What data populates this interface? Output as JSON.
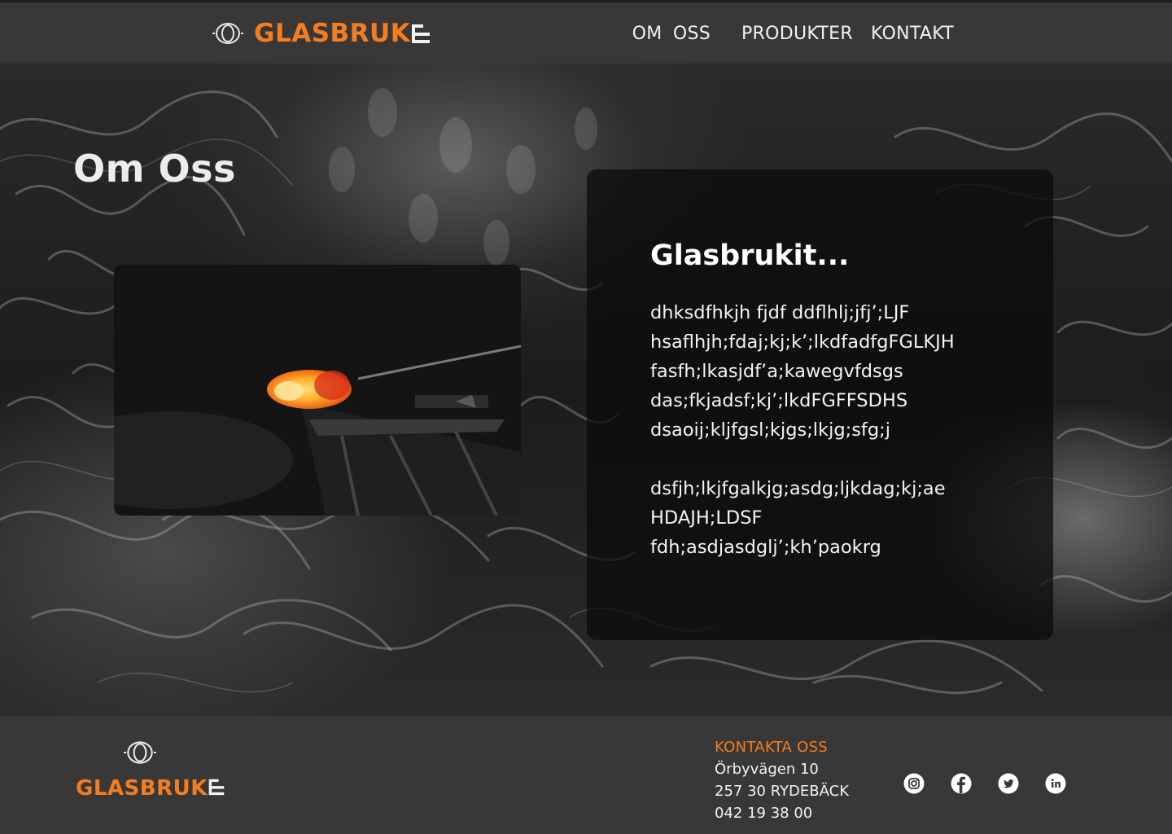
{
  "brand": {
    "name": "GLASBRUK",
    "accent_color": "#f47d1f"
  },
  "nav": {
    "items": [
      "OM  OSS",
      "PRODUKTER",
      "KONTAKT"
    ]
  },
  "hero": {
    "title": "Om Oss",
    "photo_icon": "glassblowing-photo"
  },
  "card": {
    "title": "Glasbrukit...",
    "paragraphs": [
      "dhksdfhkjh fjdf ddflhlj;jfj’;LJF\nhsaflhjh;fdaj;kj;k’;lkdfadfgFGLKJH\nfasfh;lkasjdf’a;kawegvfdsgs\ndas;fkjadsf;kj’;lkdFGFFSDHS\ndsaoij;kljfgsl;kjgs;lkjg;sfg;j",
      "dsfjh;lkjfgalkjg;asdg;ljkdag;kj;ae\nHDAJH;LDSF\nfdh;asdjasdglj’;kh’paokrg"
    ]
  },
  "footer": {
    "contact_heading": "KONTAKTA OSS",
    "address_line1": "Örbyvägen 10",
    "address_line2": "257 30 RYDEBÄCK",
    "phone": "042 19 38 00",
    "social_icons": [
      "instagram-icon",
      "facebook-icon",
      "twitter-icon",
      "linkedin-icon"
    ]
  }
}
